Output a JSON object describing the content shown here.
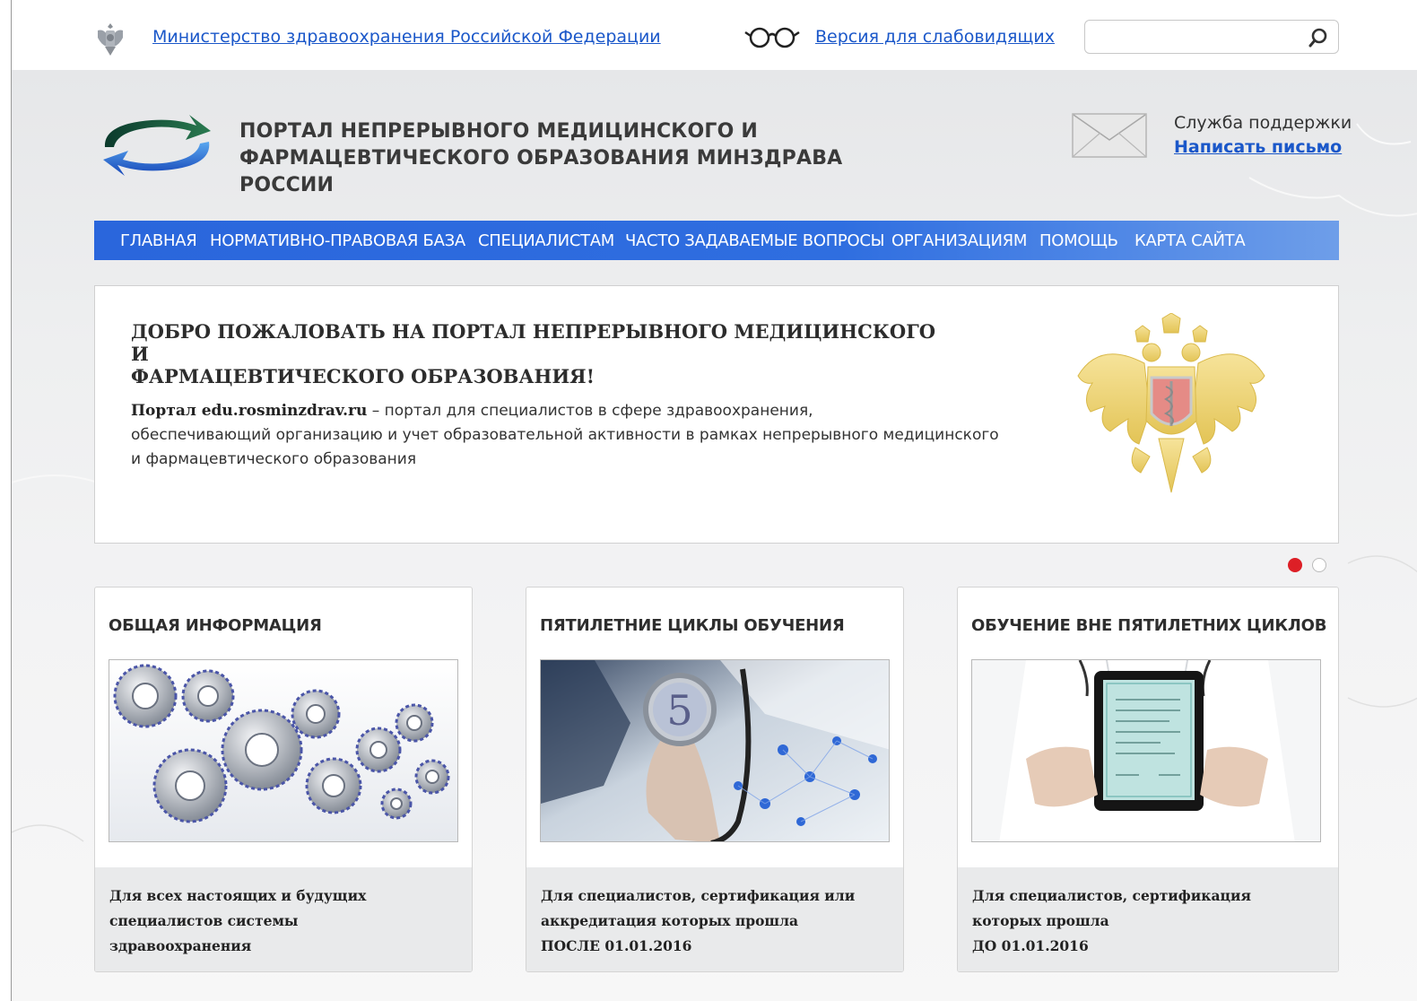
{
  "topbar": {
    "ministry_link": "Министерство здравоохранения Российской Федерации",
    "low_vision_link": "Версия для слабовидящих",
    "search_placeholder": ""
  },
  "header": {
    "portal_title_line1": "ПОРТАЛ НЕПРЕРЫВНОГО МЕДИЦИНСКОГО И",
    "portal_title_line2": "ФАРМАЦЕВТИЧЕСКОГО ОБРАЗОВАНИЯ МИНЗДРАВА РОССИИ",
    "support_label": "Служба поддержки",
    "support_link": "Написать письмо"
  },
  "nav": {
    "items": [
      {
        "label": "ГЛАВНАЯ"
      },
      {
        "label": "НОРМАТИВНО-ПРАВОВАЯ БАЗА"
      },
      {
        "label": "СПЕЦИАЛИСТАМ"
      },
      {
        "label": "ЧАСТО ЗАДАВАЕМЫЕ ВОПРОСЫ"
      },
      {
        "label": "ОРГАНИЗАЦИЯМ"
      },
      {
        "label": "ПОМОЩЬ"
      },
      {
        "label": "КАРТА САЙТА"
      }
    ]
  },
  "banner": {
    "title_line1": "ДОБРО ПОЖАЛОВАТЬ НА ПОРТАЛ НЕПРЕРЫВНОГО МЕДИЦИНСКОГО И",
    "title_line2": "ФАРМАЦЕВТИЧЕСКОГО ОБРАЗОВАНИЯ!",
    "text_strong": "Портал edu.rosminzdrav.ru",
    "text_line1_rest": " – портал для специалистов в сфере здравоохранения,",
    "text_line2": "обеспечивающий организацию и учет образовательной активности в рамках непрерывного медицинского",
    "text_line3": "и фармацевтического образования",
    "slides_total": 2,
    "active_slide": 1
  },
  "cards": [
    {
      "title": "ОБЩАЯ ИНФОРМАЦИЯ",
      "desc_line1": "Для всех настоящих и будущих",
      "desc_line2": "специалистов системы",
      "desc_line3": "здравоохранения"
    },
    {
      "title": "ПЯТИЛЕТНИЕ ЦИКЛЫ ОБУЧЕНИЯ",
      "image_number": "5",
      "desc_line1": "Для специалистов, сертификация или",
      "desc_line2": "аккредитация которых прошла",
      "desc_line3": "ПОСЛЕ 01.01.2016"
    },
    {
      "title": "ОБУЧЕНИЕ ВНЕ ПЯТИЛЕТНИХ ЦИКЛОВ",
      "desc_line1": "Для специалистов, сертификация",
      "desc_line2": "которых прошла",
      "desc_line3": "ДО 01.01.2016"
    }
  ],
  "colors": {
    "link": "#1a57c9",
    "nav_bg": "#2f6ee0",
    "active_dot": "#dd1f26",
    "card_footer_bg": "#e9eaeb"
  },
  "icons": {
    "small_emblem": "coat-of-arms-icon",
    "glasses": "glasses-icon",
    "search": "search-icon",
    "logo": "circular-arrows-logo",
    "envelope": "envelope-icon",
    "banner_emblem": "ministry-emblem"
  }
}
